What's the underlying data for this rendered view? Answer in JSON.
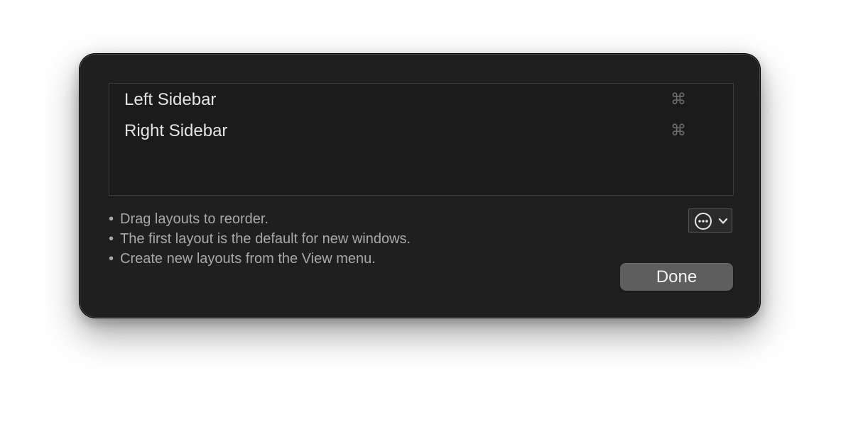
{
  "layouts": [
    {
      "name": "Left Sidebar",
      "shortcut": "⌘"
    },
    {
      "name": "Right Sidebar",
      "shortcut": "⌘"
    }
  ],
  "hints": [
    "Drag layouts to reorder.",
    "The first layout is the default for new windows.",
    "Create new layouts from the View menu."
  ],
  "bullet": "•",
  "action_menu": {
    "icons": [
      "ellipsis-circle-icon",
      "chevron-down-icon"
    ]
  },
  "done_label": "Done",
  "colors": {
    "background": "#1f1f1f",
    "list_background": "#1b1b1b",
    "button": "#5e5e5e",
    "text": "#e4e4e4",
    "hint_text": "#a9a9a9"
  }
}
